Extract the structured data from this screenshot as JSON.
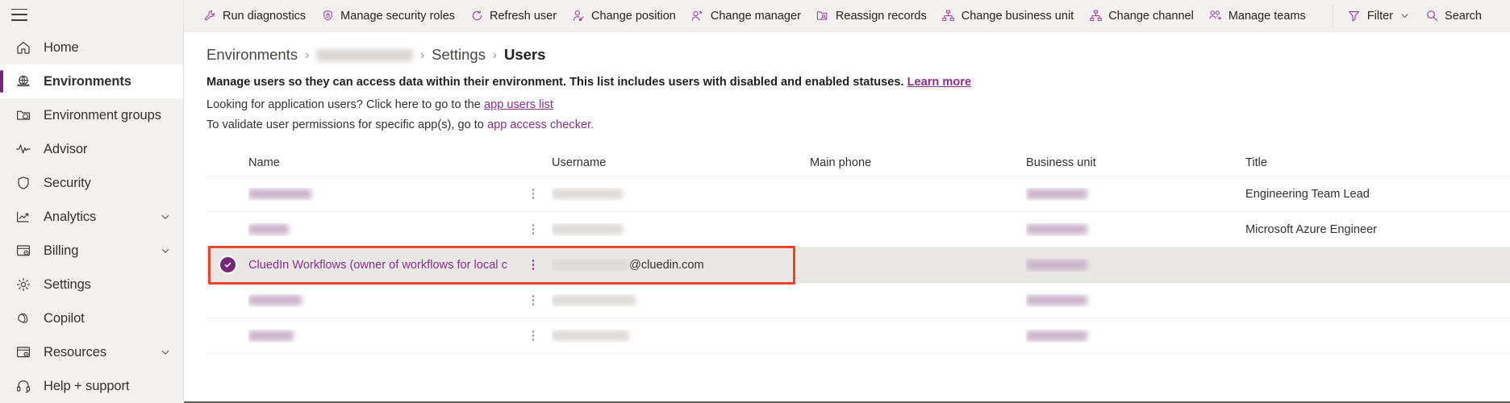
{
  "colors": {
    "accent_purple": "#742774",
    "link_purple": "#8a2f8a",
    "highlight_red": "#e8452c",
    "sidebar_bg": "#f2f1ef",
    "selected_row_bg": "#e9e7e5"
  },
  "sidebar": {
    "menu_button": "Menu",
    "items": [
      {
        "label": "Home",
        "icon": "home-icon",
        "selected": false,
        "expandable": false
      },
      {
        "label": "Environments",
        "icon": "environments-icon",
        "selected": true,
        "expandable": false
      },
      {
        "label": "Environment groups",
        "icon": "environment-groups-icon",
        "selected": false,
        "expandable": false
      },
      {
        "label": "Advisor",
        "icon": "advisor-pulse-icon",
        "selected": false,
        "expandable": false
      },
      {
        "label": "Security",
        "icon": "shield-icon",
        "selected": false,
        "expandable": false
      },
      {
        "label": "Analytics",
        "icon": "analytics-chart-icon",
        "selected": false,
        "expandable": true
      },
      {
        "label": "Billing",
        "icon": "billing-icon",
        "selected": false,
        "expandable": true
      },
      {
        "label": "Settings",
        "icon": "gear-icon",
        "selected": false,
        "expandable": false
      },
      {
        "label": "Copilot",
        "icon": "copilot-icon",
        "selected": false,
        "expandable": false
      },
      {
        "label": "Resources",
        "icon": "resources-icon",
        "selected": false,
        "expandable": true
      },
      {
        "label": "Help + support",
        "icon": "headset-icon",
        "selected": false,
        "expandable": false
      }
    ]
  },
  "commandbar": {
    "commands": [
      {
        "label": "Run diagnostics",
        "icon": "wrench-icon"
      },
      {
        "label": "Manage security roles",
        "icon": "shield-lock-icon"
      },
      {
        "label": "Refresh user",
        "icon": "refresh-icon"
      },
      {
        "label": "Change position",
        "icon": "person-settings-icon"
      },
      {
        "label": "Change manager",
        "icon": "person-arrow-icon"
      },
      {
        "label": "Reassign records",
        "icon": "reassign-records-icon"
      },
      {
        "label": "Change business unit",
        "icon": "org-hierarchy-icon"
      },
      {
        "label": "Change channel",
        "icon": "org-hierarchy-icon"
      },
      {
        "label": "Manage teams",
        "icon": "people-add-icon"
      }
    ],
    "filter": {
      "label": "Filter",
      "icon": "funnel-icon",
      "chevron": "chevron-down-icon"
    },
    "search": {
      "label": "Search",
      "icon": "search-icon"
    }
  },
  "breadcrumb": {
    "items": [
      {
        "label": "Environments",
        "redacted": false,
        "current": false
      },
      {
        "label": "",
        "redacted": true,
        "current": false
      },
      {
        "label": "Settings",
        "redacted": false,
        "current": false
      },
      {
        "label": "Users",
        "redacted": false,
        "current": true
      }
    ],
    "separator": "›"
  },
  "info": {
    "line1_text": "Manage users so they can access data within their environment. This list includes users with disabled and enabled statuses.",
    "line1_link": "Learn more",
    "line2_text": "Looking for application users? Click here to go to the",
    "line2_link": "app users list",
    "line3_text": "To validate user permissions for specific app(s), go to",
    "line3_link": "app access checker."
  },
  "table": {
    "columns": [
      "Name",
      "Username",
      "Main phone",
      "Business unit",
      "Title"
    ],
    "rows": [
      {
        "selected": false,
        "redacted": true,
        "name": "",
        "username": "",
        "main_phone": "",
        "business_unit": "",
        "title": "Engineering Team Lead",
        "name_redact_w": 78,
        "user_redact_w": 88,
        "bu_redact_w": 76
      },
      {
        "selected": false,
        "redacted": true,
        "name": "",
        "username": "",
        "main_phone": "",
        "business_unit": "",
        "title": "Microsoft Azure Engineer",
        "name_redact_w": 50,
        "user_redact_w": 88,
        "bu_redact_w": 76
      },
      {
        "selected": true,
        "redacted": false,
        "highlighted": true,
        "name": "CluedIn Workflows (owner of workflows for local c",
        "username_redacted": true,
        "username_suffix": "@cluedin.com",
        "main_phone": "",
        "business_unit": "",
        "title": "",
        "user_redact_w": 96,
        "bu_redact_w": 76
      },
      {
        "selected": false,
        "redacted": true,
        "name": "",
        "username": "",
        "main_phone": "",
        "business_unit": "",
        "title": "",
        "name_redact_w": 66,
        "user_redact_w": 104,
        "bu_redact_w": 76
      },
      {
        "selected": false,
        "redacted": true,
        "name": "",
        "username": "",
        "main_phone": "",
        "business_unit": "",
        "title": "",
        "name_redact_w": 56,
        "user_redact_w": 96,
        "bu_redact_w": 76
      }
    ]
  }
}
